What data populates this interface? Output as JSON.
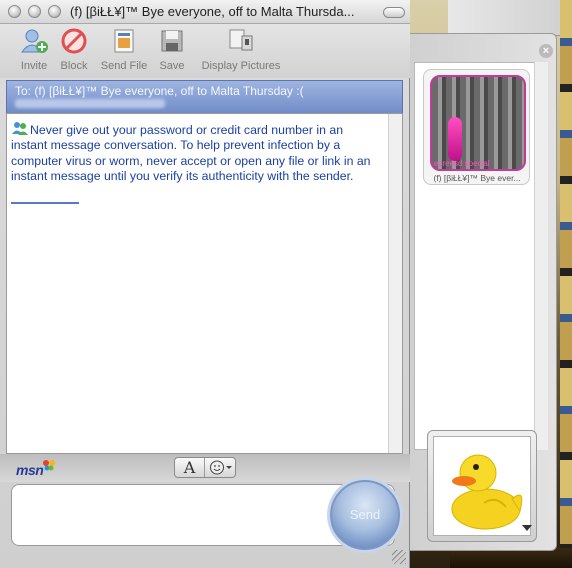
{
  "window": {
    "title": "(f) [βiŁŁ¥]™ Bye everyone, off to Malta Thursda..."
  },
  "toolbar": {
    "invite": "Invite",
    "block": "Block",
    "send_file": "Send File",
    "save": "Save",
    "display_pictures": "Display Pictures"
  },
  "recipient": {
    "to_line": "To: (f) [βiŁŁ¥]™ Bye everyone, off to Malta Thursday :("
  },
  "transcript": {
    "warning": "Never give out your password or credit card number in an instant message conversation. To help prevent infection by a computer virus or worm, never accept or open any file or link in an instant message until you verify its authenticity with the sender."
  },
  "format_bar": {
    "logo": "msn",
    "font_button": "A"
  },
  "compose": {
    "send_label": "Send",
    "value": ""
  },
  "drawer": {
    "close": "×",
    "contact_picture": {
      "caption": "ecreesd special",
      "name": "(f) [βiŁŁ¥]™ Bye ever..."
    }
  },
  "colors": {
    "accent_blue": "#1a3fa3",
    "recipient_bar": "#7f98cf",
    "picture_border": "#c23a9a"
  },
  "icons": {
    "invite": "invite-person-icon",
    "block": "block-icon",
    "send_file": "send-file-icon",
    "save": "save-icon",
    "display_pictures": "display-pictures-icon",
    "emoticon": "smiley-icon",
    "my_picture": "rubber-duck-picture"
  }
}
